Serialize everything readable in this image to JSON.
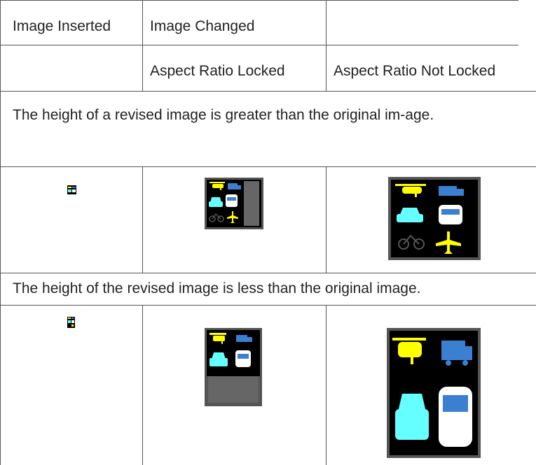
{
  "table": {
    "header_row1": {
      "col1": "Image Inserted",
      "col2": "Image Changed",
      "col3": ""
    },
    "header_row2": {
      "col1": "",
      "col2": "Aspect Ratio Locked",
      "col3": "Aspect Ratio Not Locked"
    },
    "section1_text": "The height of a revised image is greater than the original im-age.",
    "section2_text": "The height of the revised image is less than the original image."
  },
  "colors": {
    "border": "#555555",
    "icon_yellow": "#ffff00",
    "icon_blue": "#3a7fd0",
    "icon_cyan": "#66ffff",
    "icon_white": "#ffffff",
    "image_bg": "#000000",
    "image_frame": "#6a6a6a"
  },
  "icons": [
    "helicopter-icon",
    "truck-icon",
    "taxi-icon",
    "bus-icon",
    "bicycle-icon",
    "airplane-icon"
  ]
}
